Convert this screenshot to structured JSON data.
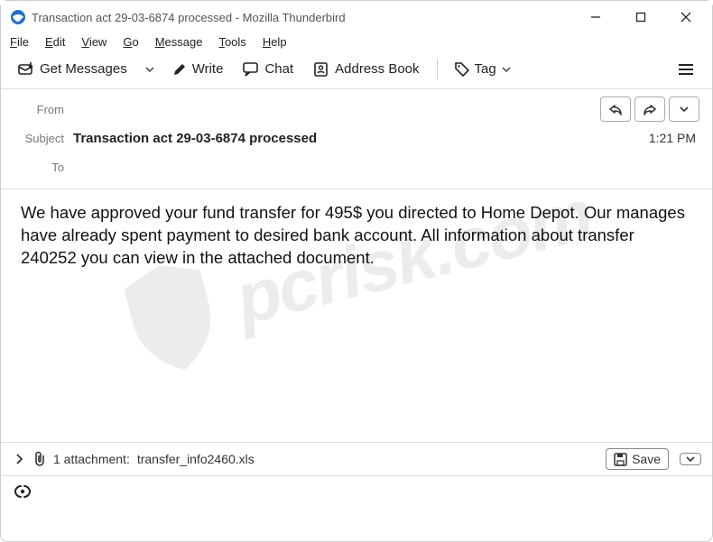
{
  "window": {
    "title": "Transaction act 29-03-6874 processed - Mozilla Thunderbird"
  },
  "menu": {
    "file": "File",
    "edit": "Edit",
    "view": "View",
    "go": "Go",
    "message": "Message",
    "tools": "Tools",
    "help": "Help"
  },
  "toolbar": {
    "get_messages": "Get Messages",
    "write": "Write",
    "chat": "Chat",
    "address_book": "Address Book",
    "tag": "Tag"
  },
  "header": {
    "from_label": "From",
    "from_value": "",
    "subject_label": "Subject",
    "subject_value": "Transaction act 29-03-6874 processed",
    "to_label": "To",
    "to_value": "",
    "time": "1:21 PM"
  },
  "body": {
    "text": "We have approved your fund transfer for 495$ you directed to Home Depot. Our manages have already spent payment to desired bank account. All information about transfer 240252 you can view in the attached document."
  },
  "attachment": {
    "count_text": "1 attachment:",
    "filename": "transfer_info2460.xls",
    "save_label": "Save"
  },
  "watermark": {
    "text": "pcrisk.com"
  }
}
